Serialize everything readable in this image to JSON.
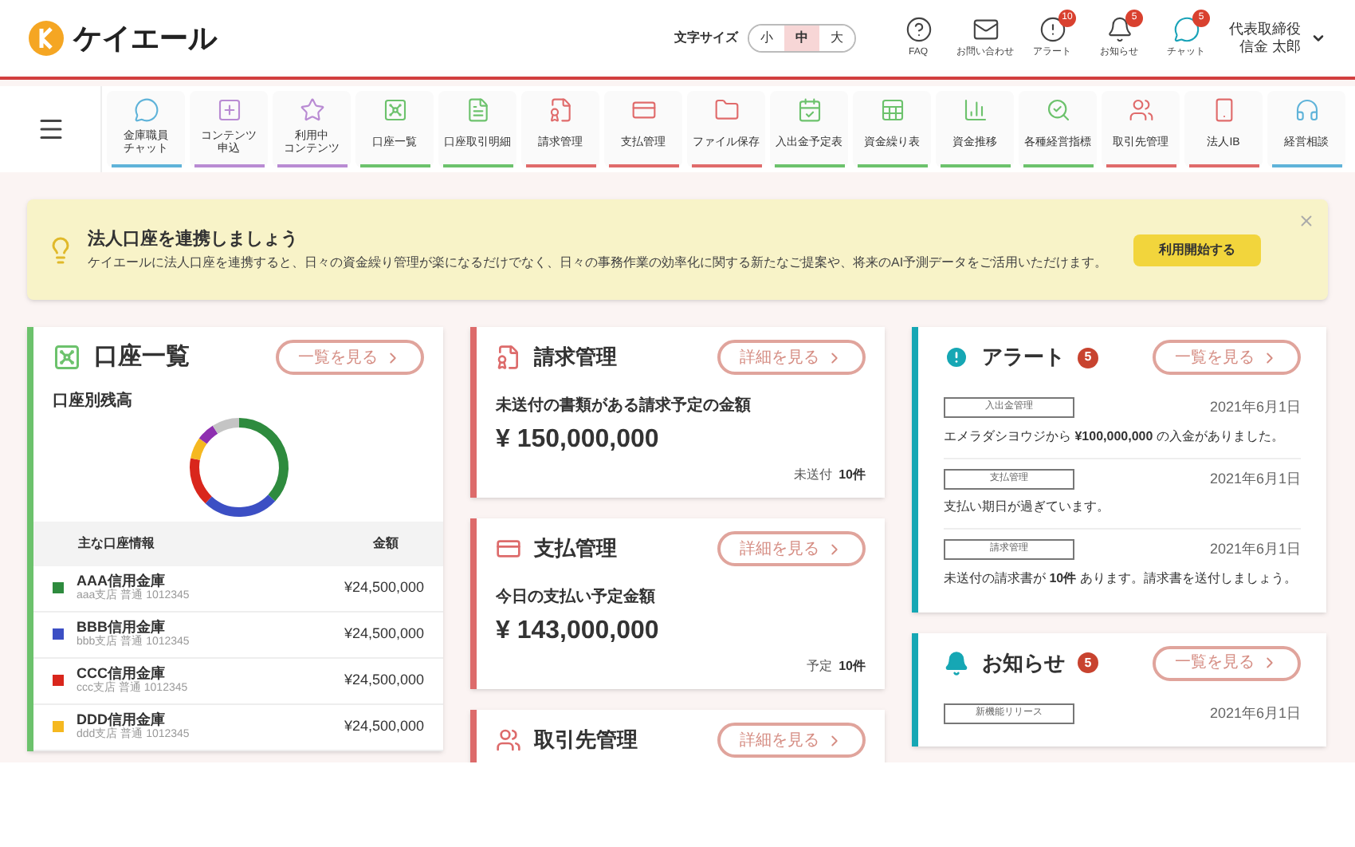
{
  "header": {
    "logo_text": "ケイエール",
    "font_size": {
      "label": "文字サイズ",
      "options": [
        {
          "label": "小",
          "selected": false
        },
        {
          "label": "中",
          "selected": true
        },
        {
          "label": "大",
          "selected": false
        }
      ]
    },
    "icons": [
      {
        "kind": "faq",
        "label": "FAQ"
      },
      {
        "kind": "mail",
        "label": "お問い合わせ"
      },
      {
        "kind": "alert",
        "label": "アラート",
        "badge": "10"
      },
      {
        "kind": "bell",
        "label": "お知らせ",
        "badge": "5"
      },
      {
        "kind": "chat",
        "label": "チャット",
        "badge": "5"
      }
    ],
    "user": {
      "role": "代表取締役",
      "name": "信金 太郎"
    }
  },
  "nav": [
    {
      "kind": "chat",
      "label": [
        "金庫職員",
        "チャット"
      ],
      "color": "#5fb3d9"
    },
    {
      "kind": "apply",
      "label": [
        "コンテンツ",
        "申込"
      ],
      "color": "#b98bd3"
    },
    {
      "kind": "star",
      "label": [
        "利用中",
        "コンテンツ"
      ],
      "color": "#b98bd3"
    },
    {
      "kind": "safe",
      "label": "口座一覧",
      "color": "#6cc26c"
    },
    {
      "kind": "doc",
      "label": "口座取引明細",
      "color": "#6cc26c"
    },
    {
      "kind": "invoice",
      "label": "請求管理",
      "color": "#e06b6b"
    },
    {
      "kind": "card",
      "label": "支払管理",
      "color": "#e06b6b"
    },
    {
      "kind": "folder",
      "label": "ファイル保存",
      "color": "#e06b6b"
    },
    {
      "kind": "calendar",
      "label": "入出金予定表",
      "color": "#6cc26c"
    },
    {
      "kind": "sheet",
      "label": "資金繰り表",
      "color": "#6cc26c"
    },
    {
      "kind": "chart",
      "label": "資金推移",
      "color": "#6cc26c"
    },
    {
      "kind": "search",
      "label": "各種経営指標",
      "color": "#6cc26c"
    },
    {
      "kind": "people",
      "label": "取引先管理",
      "color": "#e06b6b"
    },
    {
      "kind": "phone",
      "label": "法人IB",
      "color": "#e06b6b"
    },
    {
      "kind": "consult",
      "label": "経営相談",
      "color": "#5fb3d9"
    }
  ],
  "banner": {
    "title": "法人口座を連携しましょう",
    "text": "ケイエールに法人口座を連携すると、日々の資金繰り管理が楽になるだけでなく、日々の事務作業の効率化に関する新たなご提案や、将来のAI予測データをご活用いただけます。",
    "button": "利用開始する"
  },
  "accounts": {
    "title": "口座一覧",
    "link": "一覧を見る",
    "subtitle": "口座別残高",
    "columns": [
      "主な口座情報",
      "金額"
    ],
    "rows": [
      {
        "name": "AAA信用金庫",
        "detail": "aaa支店 普通 1012345",
        "amount": "¥24,500,000",
        "color": "#2e8b3e"
      },
      {
        "name": "BBB信用金庫",
        "detail": "bbb支店 普通 1012345",
        "amount": "¥24,500,000",
        "color": "#3c4fc4"
      },
      {
        "name": "CCC信用金庫",
        "detail": "ccc支店 普通 1012345",
        "amount": "¥24,500,000",
        "color": "#d9261c"
      },
      {
        "name": "DDD信用金庫",
        "detail": "ddd支店 普通 1012345",
        "amount": "¥24,500,000",
        "color": "#f5b820"
      }
    ]
  },
  "summary_cards": [
    {
      "kind": "invoice",
      "title": "請求管理",
      "link": "詳細を見る",
      "label": "未送付の書類がある請求予定の金額",
      "amount": "¥ 150,000,000",
      "note_label": "未送付",
      "note_value": "10件"
    },
    {
      "kind": "card",
      "title": "支払管理",
      "link": "詳細を見る",
      "label": "今日の支払い予定金額",
      "amount": "¥ 143,000,000",
      "note_label": "予定",
      "note_value": "10件"
    },
    {
      "kind": "people",
      "title": "取引先管理",
      "link": "詳細を見る"
    }
  ],
  "alerts": {
    "title": "アラート",
    "count": "5",
    "link": "一覧を見る",
    "items": [
      {
        "tag": "入出金管理",
        "date": "2021年6月1日",
        "text": "エメラダシヨウジから **¥100,000,000** の入金がありました。"
      },
      {
        "tag": "支払管理",
        "date": "2021年6月1日",
        "text": "支払い期日が過ぎています。"
      },
      {
        "tag": "請求管理",
        "date": "2021年6月1日",
        "text": "未送付の請求書が **10件** あります。請求書を送付しましょう。"
      }
    ]
  },
  "notices": {
    "title": "お知らせ",
    "count": "5",
    "link": "一覧を見る",
    "items": [
      {
        "tag": "新機能リリース",
        "date": "2021年6月1日"
      }
    ]
  }
}
